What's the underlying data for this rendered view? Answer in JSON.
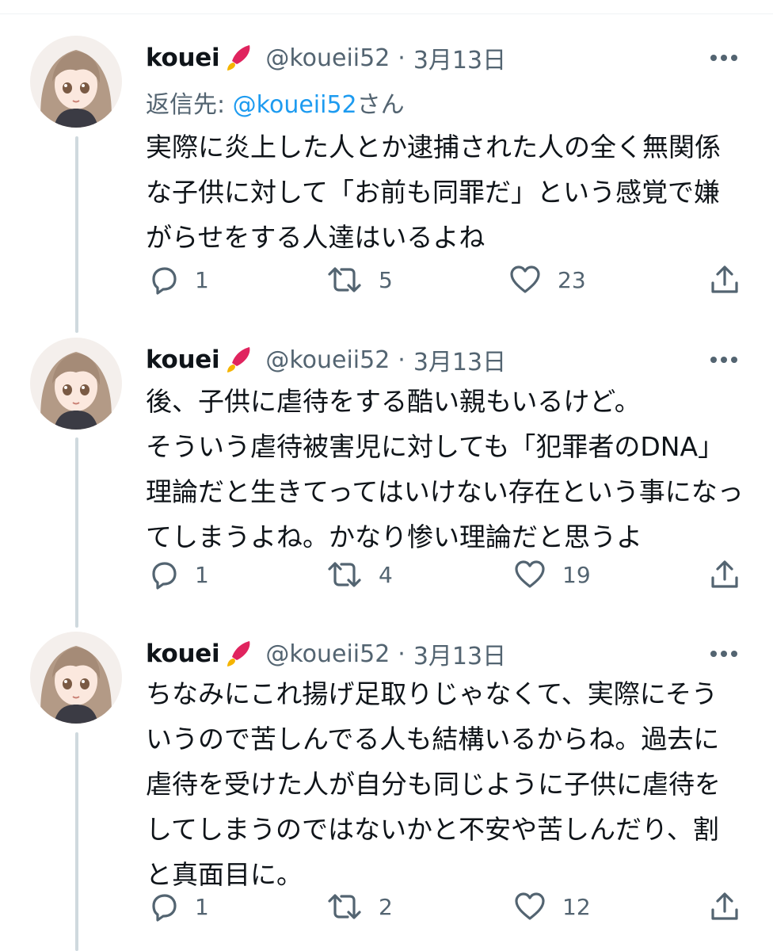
{
  "tweets": [
    {
      "name": "kouei",
      "handle": "@koueii52",
      "separator": "·",
      "date": "3月13日",
      "reply_label": "返信先: ",
      "reply_mention": "@koueii52",
      "reply_suffix": "さん",
      "lines": [
        "実際に炎上した人とか逮捕された人の全く無関係",
        "な子供に対して「お前も同罪だ」という感覚で嫌",
        "がらせをする人達はいるよね"
      ],
      "replies": "1",
      "retweets": "5",
      "likes": "23"
    },
    {
      "name": "kouei",
      "handle": "@koueii52",
      "separator": "·",
      "date": "3月13日",
      "lines": [
        "後、子供に虐待をする酷い親もいるけど。",
        "そういう虐待被害児に対しても「犯罪者のDNA」",
        "理論だと生きてってはいけない存在という事になっ",
        "てしまうよね。かなり惨い理論だと思うよ"
      ],
      "replies": "1",
      "retweets": "4",
      "likes": "19"
    },
    {
      "name": "kouei",
      "handle": "@koueii52",
      "separator": "·",
      "date": "3月13日",
      "lines": [
        "ちなみにこれ揚げ足取りじゃなくて、実際にそう",
        "いうので苦しんでる人も結構いるからね。過去に",
        "虐待を受けた人が自分も同じように子供に虐待を",
        "してしまうのではないかと不安や苦しんだり、割",
        "と真面目に。"
      ],
      "replies": "1",
      "retweets": "2",
      "likes": "12"
    }
  ],
  "icons": {
    "avatar": "anime-avatar",
    "badge": "rocket-badge-icon",
    "more": "more-icon",
    "reply": "reply-icon",
    "retweet": "retweet-icon",
    "like": "heart-icon",
    "share": "share-icon"
  },
  "colors": {
    "text": "#0f1419",
    "secondary": "#536471",
    "link": "#1d9bf0",
    "thread_line": "#cfd9de",
    "badge_red": "#e0245e",
    "badge_gold": "#f5b400"
  }
}
